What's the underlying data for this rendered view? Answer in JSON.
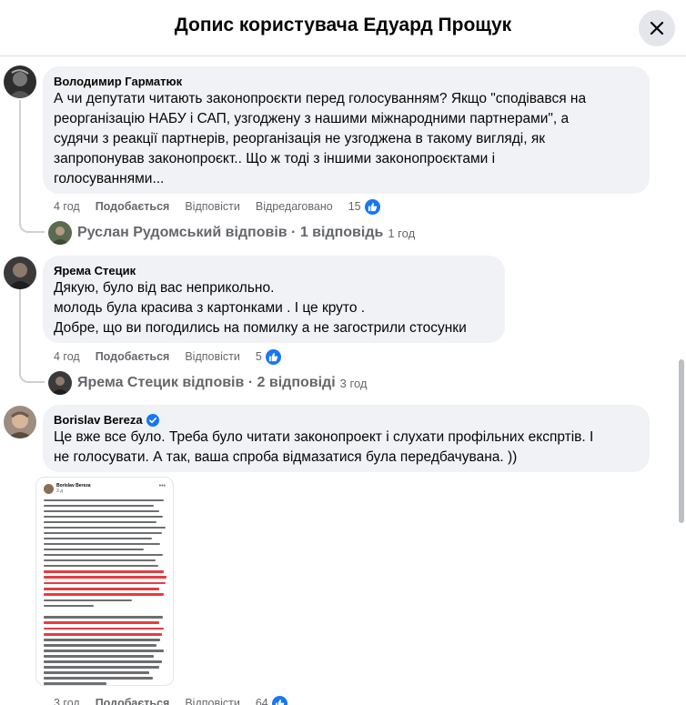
{
  "header": {
    "title": "Допис користувача Едуард Прощук",
    "close_icon": "close-icon"
  },
  "comments": [
    {
      "author": "Володимир Гарматюк",
      "text": "А чи депутати читають законопроєкти перед голосуванням? Якщо \"сподівався на\nреорганізацію НАБУ і САП, узгоджену з нашими міжнародними партнерами\", а\nсудячи з реакції партнерів, реорганізація не узгоджена в такому вигляді, як\nзапропонував законопроєкт.. Що ж тоді з іншими законопроєктами і\nголосуваннями...",
      "time": "4 год",
      "like": "Подобається",
      "reply": "Відповісти",
      "edited": "Відредаговано",
      "reactions": "15",
      "replies": {
        "name": "Руслан Рудомський відповів · 1 відповідь",
        "time": "1 год"
      }
    },
    {
      "author": "Ярема Стецик",
      "text": "Дякую, було від вас неприкольно.\nмолодь була красива з картонками . І це круто .\nДобре, що ви погодились на помилку а не загострили стосунки",
      "time": "4 год",
      "like": "Подобається",
      "reply": "Відповісти",
      "reactions": "5",
      "replies": {
        "name": "Ярема Стецик відповів · 2 відповіді",
        "time": "3 год"
      }
    },
    {
      "author": "Borislav Bereza",
      "verified_icon": "verified-badge-icon",
      "text": "Це вже все було. Треба було читати законопроект і слухати профільних експртів. І\nне голосувати. А так, ваша спроба відмазатися була передбачувана. ))",
      "attachment": {
        "author": "Borislav Bereza",
        "time": "3 д"
      },
      "time": "3 год",
      "like": "Подобається",
      "reply": "Відповісти",
      "reactions": "64"
    }
  ],
  "colors": {
    "accent": "#1877f2",
    "bubble": "#f0f2f5",
    "meta": "#65676b",
    "highlight": "#e4262b"
  }
}
